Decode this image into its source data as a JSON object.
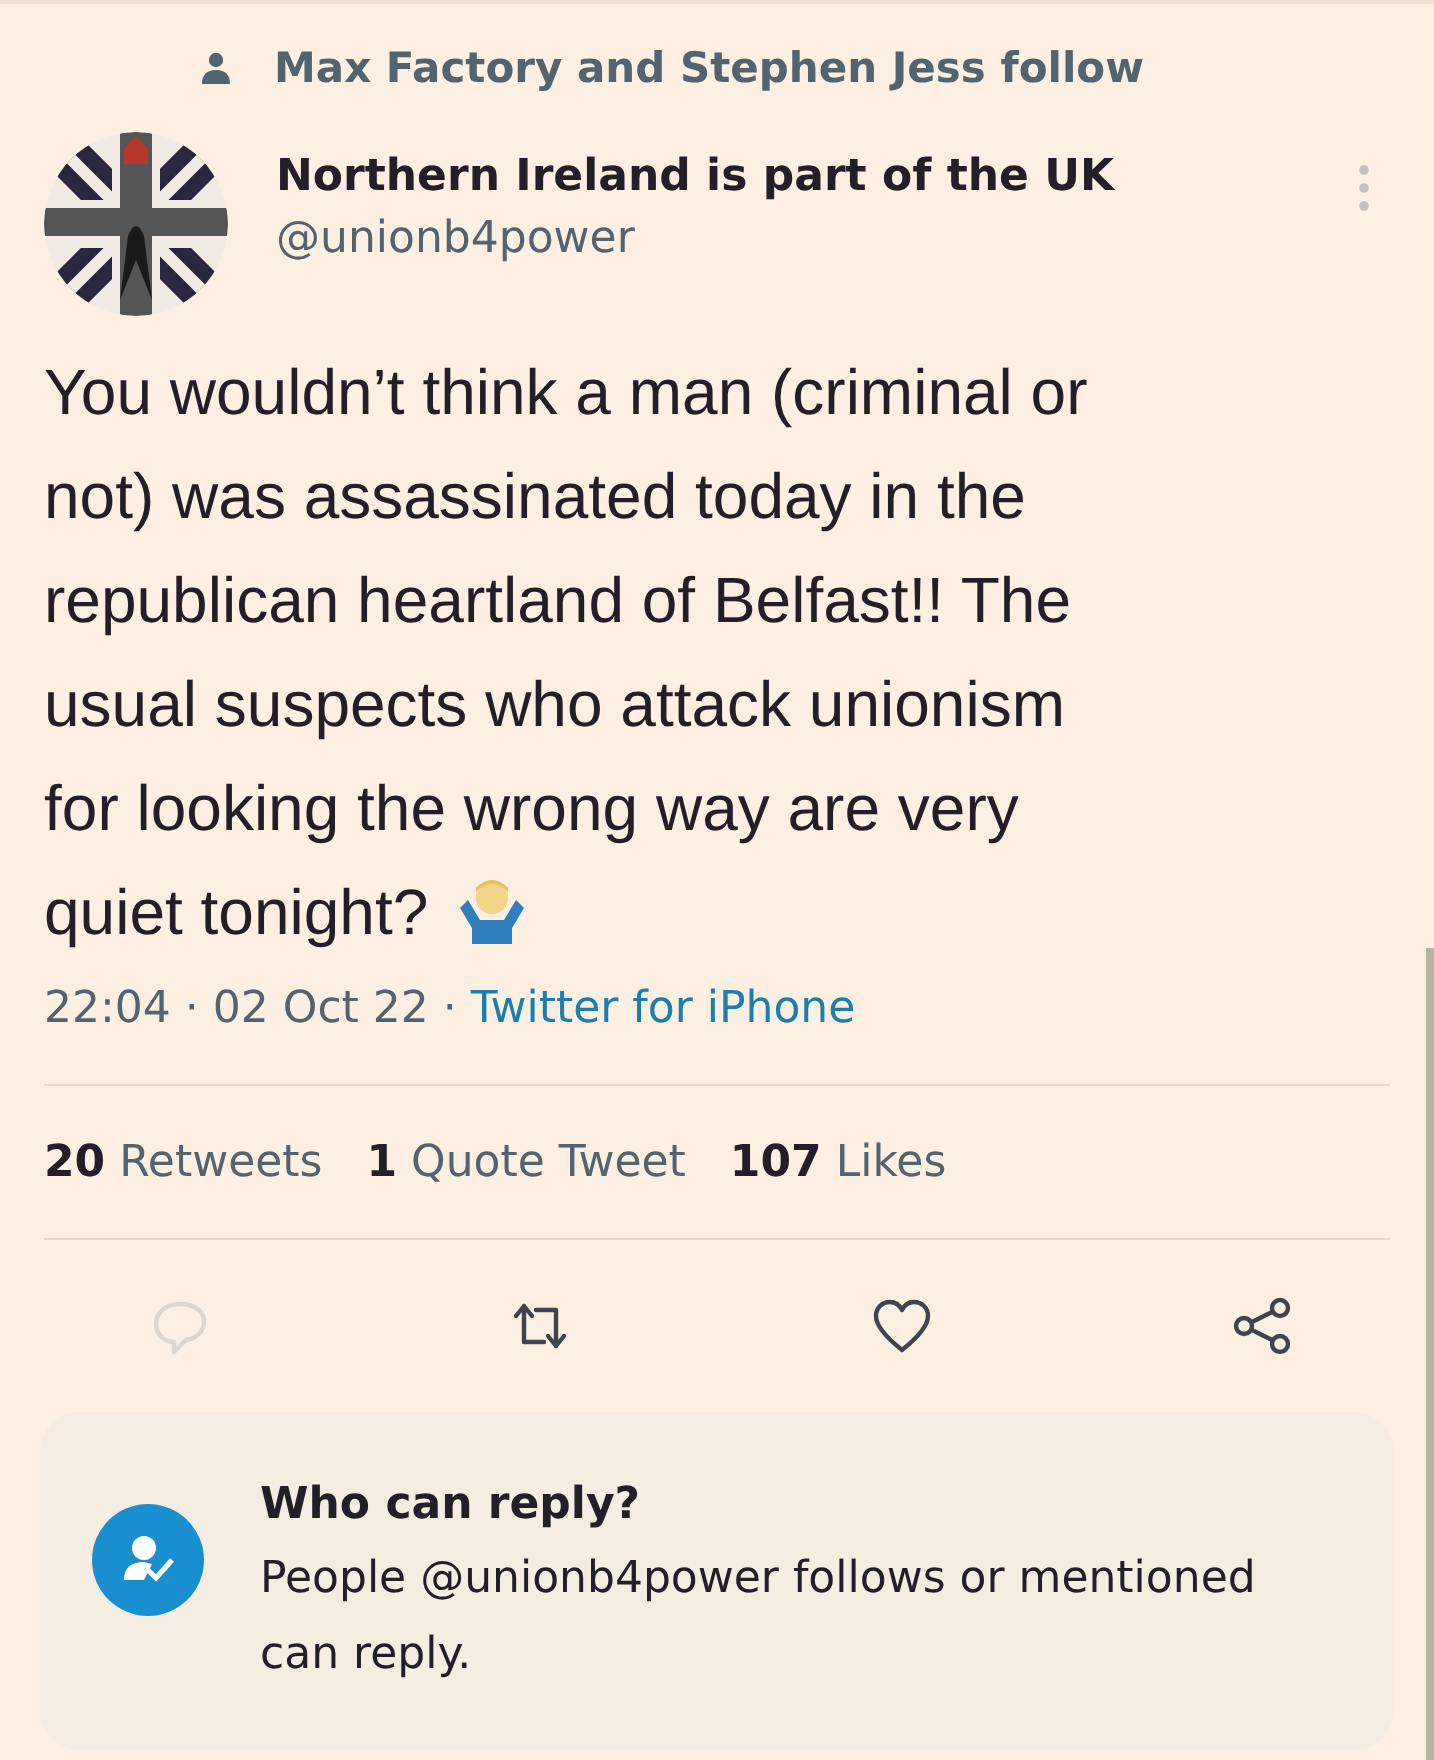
{
  "social_context": "Max Factory and Stephen Jess follow",
  "author": {
    "name": "Northern Ireland is part of the UK",
    "handle": "@unionb4power"
  },
  "text_lines": [
    "You wouldn’t think a man (criminal or",
    "not) was assassinated today in the",
    "republican heartland of Belfast!! The",
    "usual suspects who attack unionism",
    "for looking the wrong way are very",
    "quiet tonight?"
  ],
  "meta": {
    "time": "22:04",
    "separator_1": "·",
    "date": "02 Oct 22",
    "separator_2": "·",
    "source": "Twitter for iPhone"
  },
  "stats": [
    {
      "count": "20",
      "label": "Retweets"
    },
    {
      "count": "1",
      "label": "Quote Tweet"
    },
    {
      "count": "107",
      "label": "Likes"
    }
  ],
  "actions": [
    {
      "kind": "reply",
      "disabled": true
    },
    {
      "kind": "retweet",
      "disabled": false
    },
    {
      "kind": "like",
      "disabled": false
    },
    {
      "kind": "share",
      "disabled": false
    }
  ],
  "reply_settings": {
    "title": "Who can reply?",
    "description": "People @unionb4power follows or mentioned can reply."
  }
}
